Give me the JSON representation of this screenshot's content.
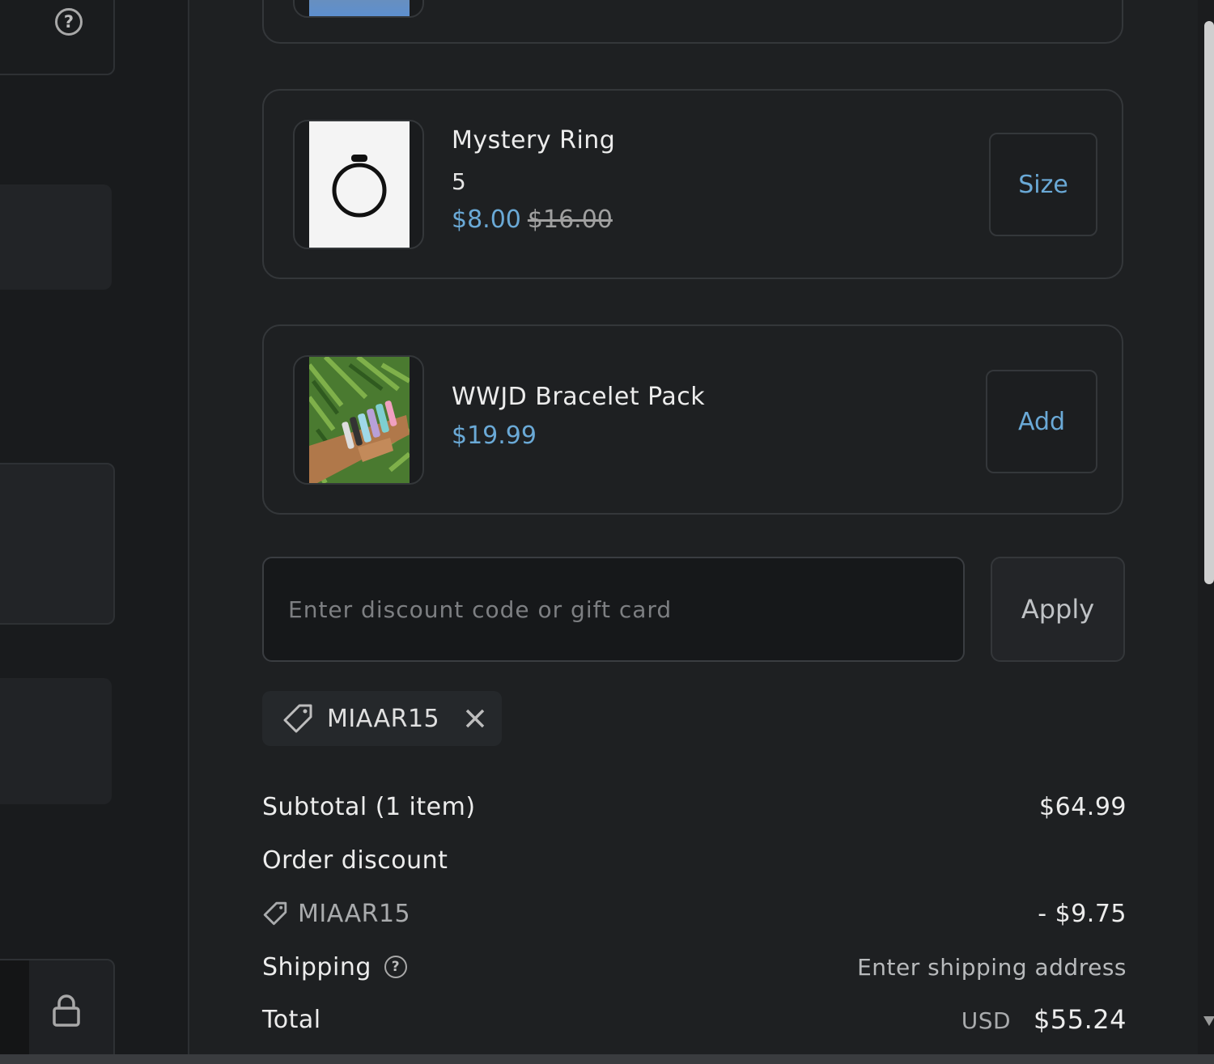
{
  "help_icon": "question-circle-icon",
  "lock_icon": "lock-icon",
  "products": {
    "ring": {
      "title": "Mystery Ring",
      "variant": "5",
      "price": "$8.00",
      "compare_price": "$16.00",
      "button_label": "Size"
    },
    "bracelet": {
      "title": "WWJD Bracelet Pack",
      "price": "$19.99",
      "button_label": "Add"
    }
  },
  "discount": {
    "placeholder": "Enter discount code or gift card",
    "value": "",
    "apply_label": "Apply",
    "applied_code": "MIAAR15"
  },
  "summary": {
    "subtotal_label": "Subtotal (1 item)",
    "subtotal_value": "$64.99",
    "order_discount_label": "Order discount",
    "discount_code": "MIAAR15",
    "discount_value": "- $9.75",
    "shipping_label": "Shipping",
    "shipping_value": "Enter shipping address",
    "total_label": "Total",
    "total_currency": "USD",
    "total_value": "$55.24"
  },
  "colors": {
    "accent": "#6aa9d6",
    "background": "#1e2022",
    "border": "#34373a"
  }
}
